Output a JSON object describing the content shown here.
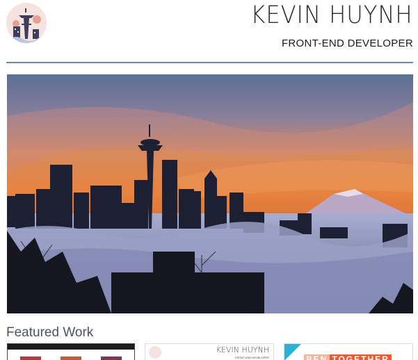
{
  "header": {
    "name": "KEVIN HUYNH",
    "role": "FRONT-END DEVELOPER",
    "logo_icon": "space-needle-icon"
  },
  "hero": {
    "description_icon": "seattle-skyline-photo"
  },
  "featured": {
    "title": "Featured Work",
    "projects": [
      {
        "thumb_text": ""
      },
      {
        "name": "KEVIN HUYNH",
        "role": "FRONT-END DEVELOPER"
      },
      {
        "word1": "BEN",
        "word2": "TOGETHER"
      }
    ]
  },
  "colors": {
    "rule": "#6b8aa6",
    "logo_bg": "#f6e2df",
    "accent_orange": "#f05a28",
    "accent_blue": "#2bb0d6"
  }
}
